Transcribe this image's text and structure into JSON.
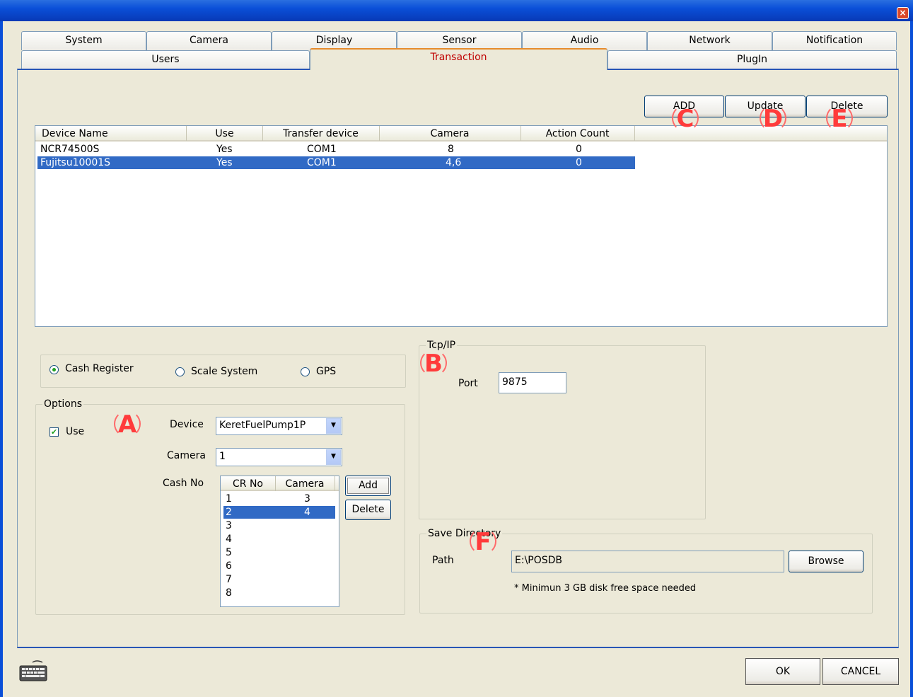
{
  "window": {
    "close_glyph": "×"
  },
  "tabs_row1": [
    "System",
    "Camera",
    "Display",
    "Sensor",
    "Audio",
    "Network",
    "Notification"
  ],
  "tabs_row2": [
    "Users",
    "Transaction",
    "PlugIn"
  ],
  "toolbar": {
    "add": "ADD",
    "update": "Update",
    "delete": "Delete"
  },
  "device_list": {
    "columns": [
      "Device Name",
      "Use",
      "Transfer device",
      "Camera",
      "Action Count"
    ],
    "rows": [
      [
        "NCR74500S",
        "Yes",
        "COM1",
        "8",
        "0"
      ],
      [
        "Fujitsu10001S",
        "Yes",
        "COM1",
        "4,6",
        "0"
      ]
    ],
    "selected_row": 1
  },
  "mode": {
    "options": [
      "Cash Register",
      "Scale System",
      "GPS"
    ],
    "selected": "Cash Register"
  },
  "options": {
    "legend": "Options",
    "use_label": "Use",
    "use_checked": true,
    "device_label": "Device",
    "device_value": "KeretFuelPump1P",
    "camera_label": "Camera",
    "camera_value": "1",
    "cashno_label": "Cash No",
    "cash_columns": [
      "CR No",
      "Camera"
    ],
    "cash_rows": [
      [
        "1",
        "3"
      ],
      [
        "2",
        "4"
      ],
      [
        "3",
        ""
      ],
      [
        "4",
        ""
      ],
      [
        "5",
        ""
      ],
      [
        "6",
        ""
      ],
      [
        "7",
        ""
      ],
      [
        "8",
        ""
      ]
    ],
    "cash_selected_row": 1,
    "add_label": "Add",
    "delete_label": "Delete"
  },
  "tcpip": {
    "legend": "Tcp/IP",
    "port_label": "Port",
    "port_value": "9875"
  },
  "save_dir": {
    "legend": "Save Directory",
    "path_label": "Path",
    "path_value": "E:\\POSDB",
    "browse_label": "Browse",
    "note": "* Minimun 3 GB disk free space needed"
  },
  "markers": {
    "a": "A",
    "b": "B",
    "c": "C",
    "d": "D",
    "e": "E",
    "f": "F"
  },
  "footer": {
    "ok": "OK",
    "cancel": "CANCEL",
    "icon": "keyboard-icon"
  },
  "colors": {
    "selection": "#316ac5",
    "marker": "#ff3b3b",
    "active_tab_text": "#c00000"
  }
}
